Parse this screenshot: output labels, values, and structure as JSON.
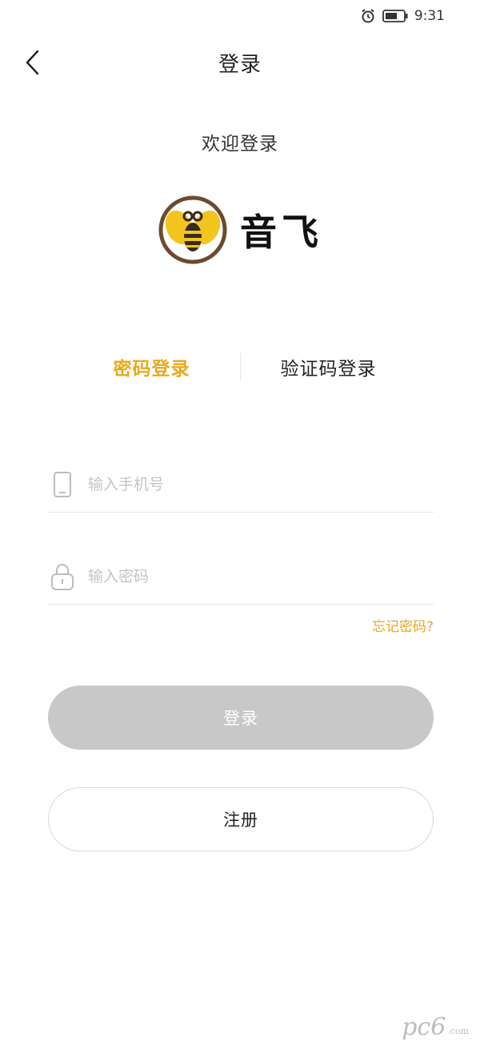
{
  "status_bar": {
    "time": "9:31",
    "icons": [
      "alarm-icon",
      "battery-icon"
    ]
  },
  "nav": {
    "title": "登录",
    "back_icon": "chevron-left-icon"
  },
  "welcome_text": "欢迎登录",
  "brand": {
    "name": "音飞",
    "logo_icon": "bee-logo-icon"
  },
  "tabs": [
    {
      "label": "密码登录",
      "active": true
    },
    {
      "label": "验证码登录",
      "active": false
    }
  ],
  "form": {
    "phone": {
      "placeholder": "输入手机号",
      "value": "",
      "icon": "phone-icon"
    },
    "password": {
      "placeholder": "输入密码",
      "value": "",
      "icon": "lock-icon"
    },
    "forgot_label": "忘记密码?"
  },
  "buttons": {
    "login_label": "登录",
    "register_label": "注册"
  },
  "watermark": {
    "text": "pc6",
    "subtext": ".com"
  },
  "colors": {
    "accent": "#E9A81C",
    "disabled_button": "#C8C8C8",
    "divider": "#E6E6E6"
  }
}
